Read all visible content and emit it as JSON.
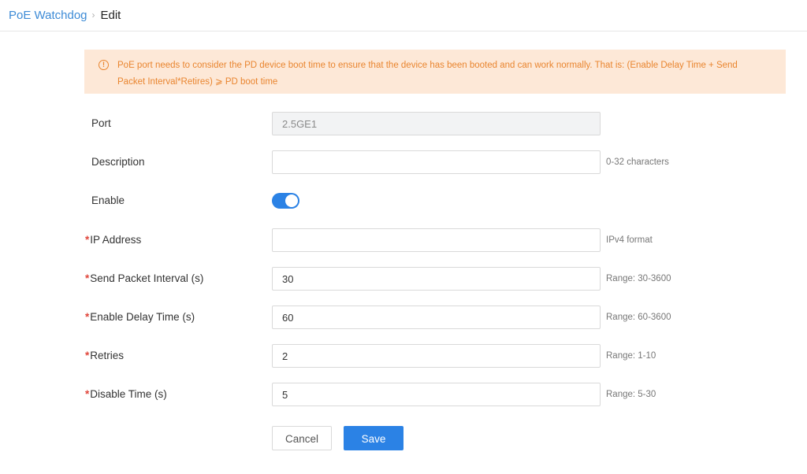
{
  "breadcrumb": {
    "parent": "PoE Watchdog",
    "separator": "›",
    "current": "Edit"
  },
  "notice": {
    "icon": "warning-circle-icon",
    "text": "PoE port needs to consider the PD device boot time to ensure that the device has been booted and can work normally. That is: (Enable Delay Time + Send Packet Interval*Retires) ⩾ PD boot time"
  },
  "form": {
    "required_mark": "*",
    "port": {
      "label": "Port",
      "value": "2.5GE1"
    },
    "description": {
      "label": "Description",
      "value": "",
      "hint": "0-32 characters"
    },
    "enable": {
      "label": "Enable",
      "on": true
    },
    "ip_address": {
      "label": "IP Address",
      "value": "",
      "hint": "IPv4 format"
    },
    "send_packet_interval": {
      "label": "Send Packet Interval (s)",
      "value": "30",
      "hint": "Range: 30-3600"
    },
    "enable_delay_time": {
      "label": "Enable Delay Time (s)",
      "value": "60",
      "hint": "Range: 60-3600"
    },
    "retries": {
      "label": "Retries",
      "value": "2",
      "hint": "Range: 1-10"
    },
    "disable_time": {
      "label": "Disable Time (s)",
      "value": "5",
      "hint": "Range: 5-30"
    }
  },
  "buttons": {
    "cancel": "Cancel",
    "save": "Save"
  },
  "colors": {
    "accent": "#2b82e5",
    "link": "#3d8bd6",
    "warning_text": "#e9852f",
    "warning_bg": "#fde8d7",
    "required": "#e0463b"
  }
}
